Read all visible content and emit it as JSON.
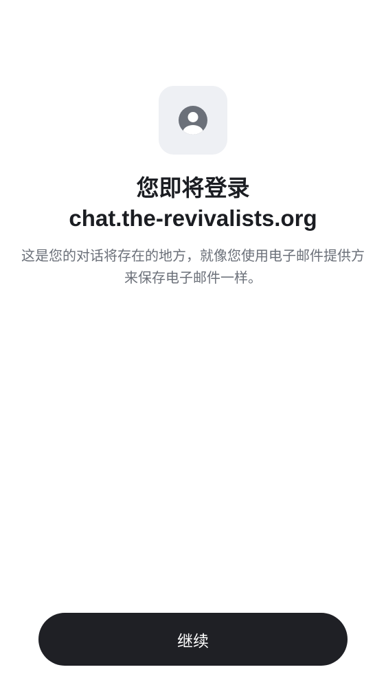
{
  "header": {
    "title_line1": "您即将登录",
    "title_line2": "chat.the-revivalists.org"
  },
  "description": {
    "text": "这是您的对话将存在的地方，就像您使用电子邮件提供方来保存电子邮件一样。"
  },
  "icons": {
    "avatar": "user-circle-icon"
  },
  "actions": {
    "continue_label": "继续"
  },
  "colors": {
    "background": "#ffffff",
    "avatar_tile": "#eef0f4",
    "avatar_icon": "#6b7079",
    "title_text": "#1b1d22",
    "description_text": "#6b7079",
    "button_background": "#1f2025",
    "button_text": "#ffffff"
  }
}
